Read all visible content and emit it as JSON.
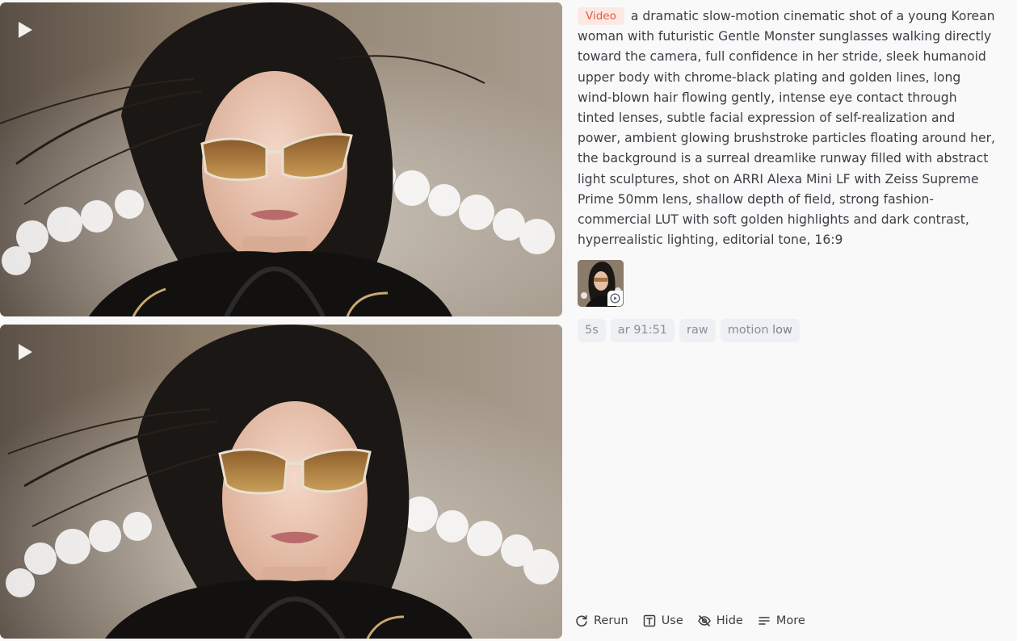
{
  "videos": [
    {
      "play_icon": "play-icon"
    },
    {
      "play_icon": "play-icon"
    }
  ],
  "prompt": {
    "badge": "Video",
    "text": "a dramatic slow-motion cinematic shot of a young Korean woman with futuristic Gentle Monster sunglasses walking directly toward the camera, full confidence in her stride, sleek humanoid upper body with chrome-black plating and golden lines, long wind-blown hair flowing gently, intense eye contact through tinted lenses, subtle facial expression of self-realization and power, ambient glowing brushstroke particles floating around her, the background is a surreal dreamlike runway filled with abstract light sculptures, shot on ARRI Alexa Mini LF with Zeiss Supreme Prime 50mm lens, shallow depth of field, strong fashion-commercial LUT with soft golden highlights and dark contrast, hyperrealistic lighting, editorial tone, 16:9"
  },
  "reference": {
    "icon": "play-circle-icon"
  },
  "tags": {
    "duration": "5s",
    "aspect": "ar 91:51",
    "style": "raw",
    "motion_label": "motion",
    "motion_value": "low"
  },
  "actions": {
    "rerun": "Rerun",
    "use": "Use",
    "hide": "Hide",
    "more": "More"
  },
  "colors": {
    "badge_bg": "#fde9e4",
    "badge_text": "#e4593f",
    "tag_bg": "#eef0f3",
    "tag_text": "#8a8f98",
    "body_text": "#3d3d45",
    "page_bg": "#f9f9fa"
  }
}
